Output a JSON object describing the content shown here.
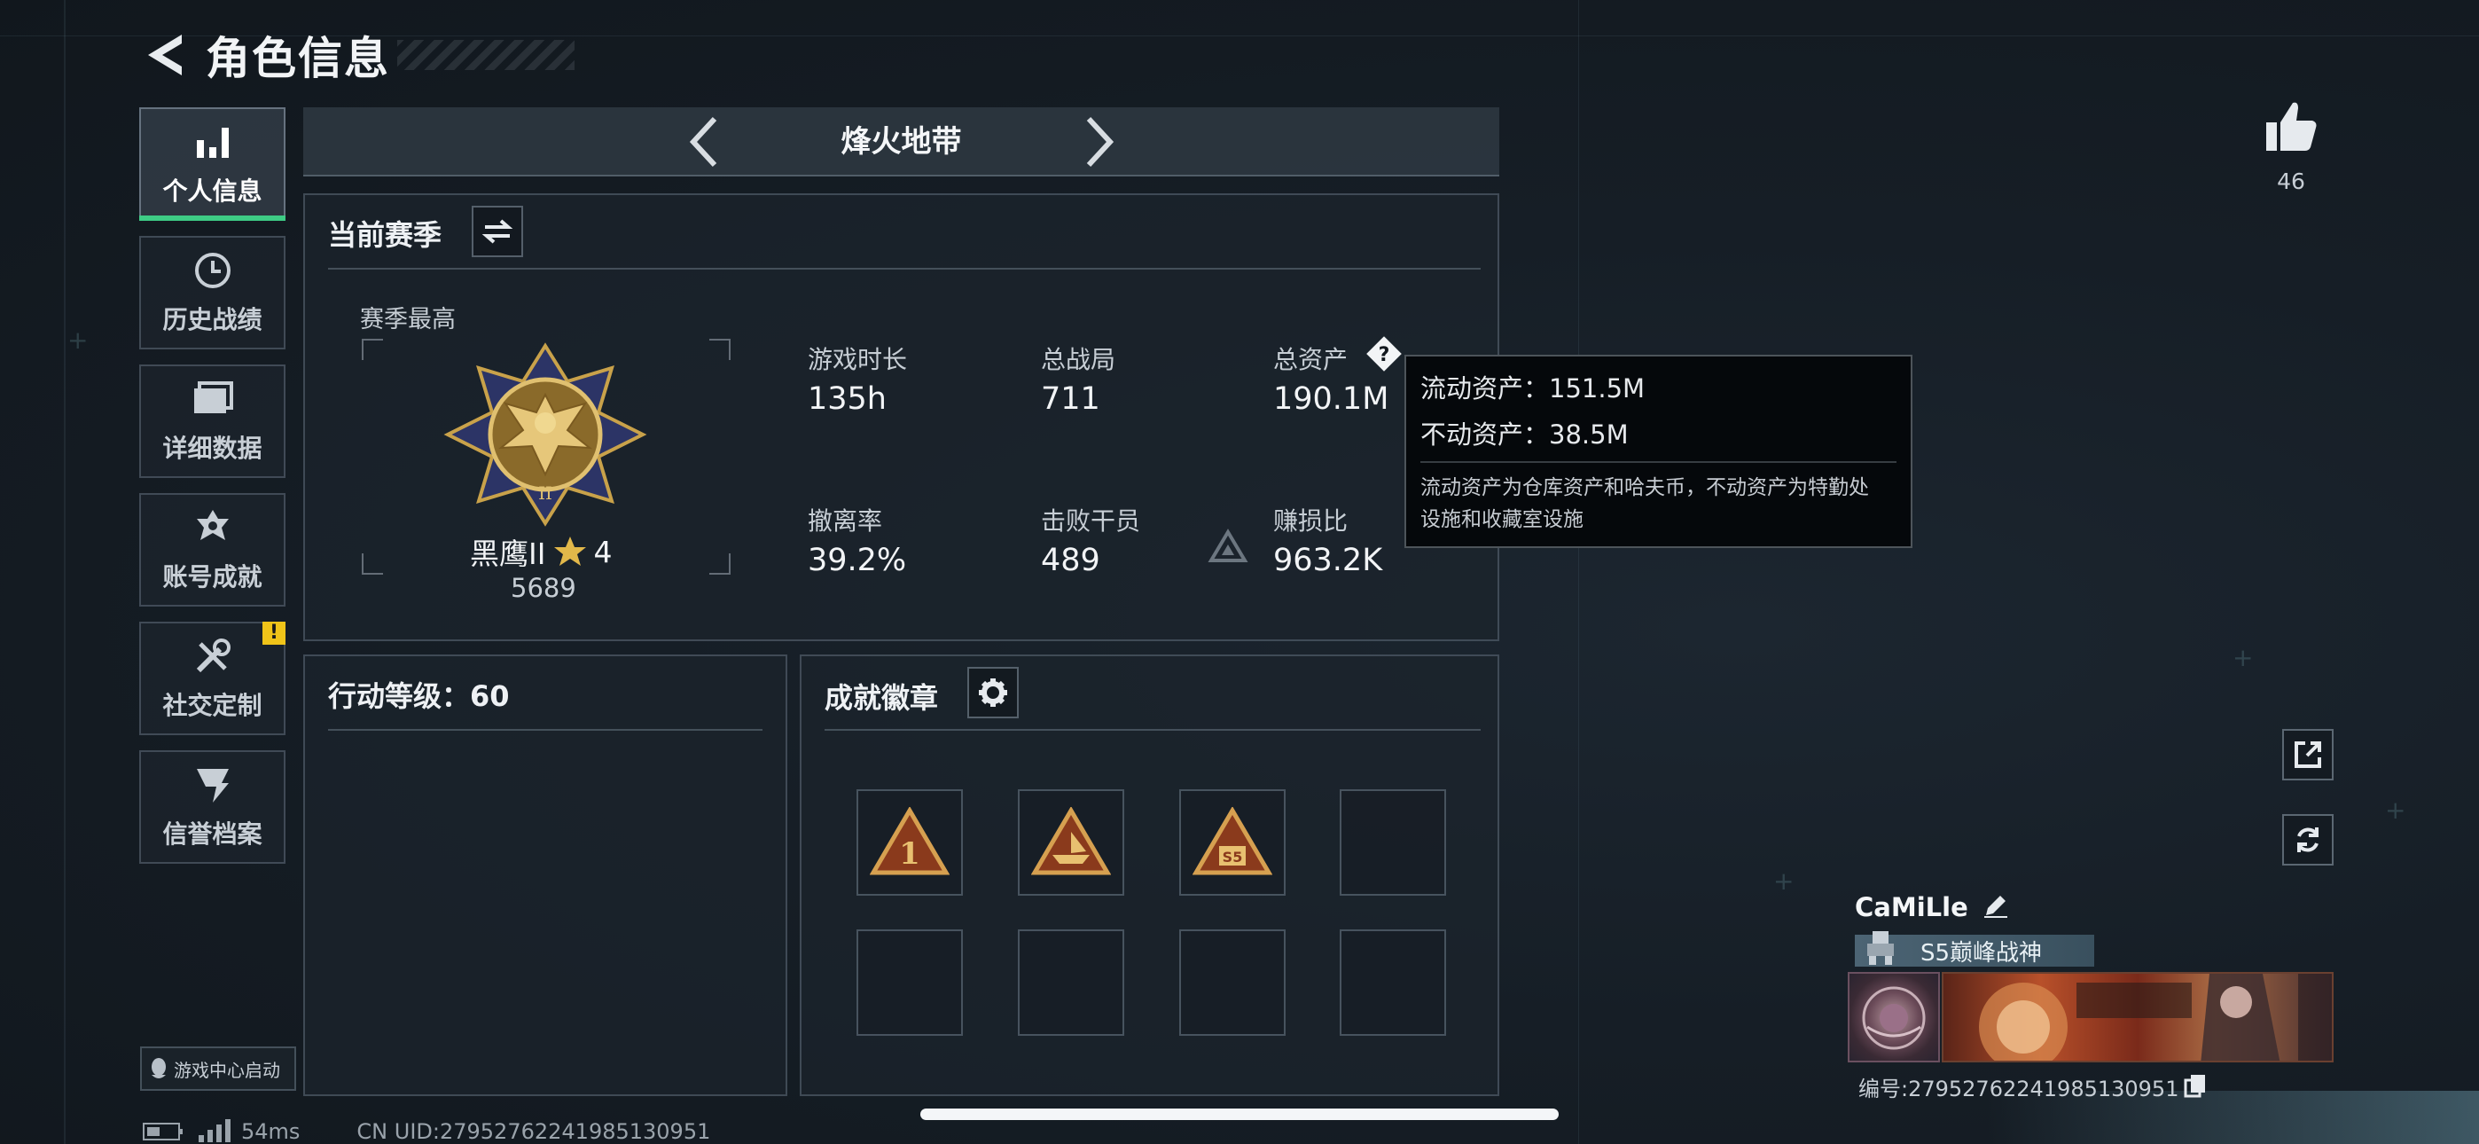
{
  "header": {
    "title": "角色信息"
  },
  "nav": {
    "items": [
      {
        "label": "个人信息",
        "active": true
      },
      {
        "label": "历史战绩"
      },
      {
        "label": "详细数据"
      },
      {
        "label": "账号成就"
      },
      {
        "label": "社交定制",
        "badge": "!"
      },
      {
        "label": "信誉档案"
      }
    ],
    "game_center": "游戏中心启动"
  },
  "mode": {
    "title": "烽火地带"
  },
  "season": {
    "title": "当前赛季",
    "best_label": "赛季最高",
    "rank_name": "黑鹰II",
    "rank_stars": "4",
    "rank_score": "5689",
    "stats": [
      {
        "label": "游戏时长",
        "value": "135h"
      },
      {
        "label": "总战局",
        "value": "711"
      },
      {
        "label": "总资产",
        "value": "190.1M"
      },
      {
        "label": "撤离率",
        "value": "39.2%"
      },
      {
        "label": "击败干员",
        "value": "489"
      },
      {
        "label": "赚损比",
        "value": "963.2K"
      }
    ]
  },
  "tooltip": {
    "liquid": "流动资产：151.5M",
    "fixed": "不动资产：38.5M",
    "note_line1": "流动资产为仓库资产和哈夫币，不动资产为特勤处",
    "note_line2": "设施和收藏室设施"
  },
  "action_level": {
    "title": "行动等级：60"
  },
  "achievements": {
    "title": "成就徽章",
    "badges": [
      "1",
      "ship",
      "S5",
      "",
      "",
      "",
      "",
      ""
    ]
  },
  "likes": {
    "count": "46"
  },
  "profile": {
    "name": "CaMiLle",
    "title_tag": "S5巅峰战神",
    "id_text": "编号:27952762241985130951"
  },
  "status_bar": {
    "ping": "54ms",
    "uid": "CN UID:27952762241985130951"
  },
  "colors": {
    "accent": "#3ecc85",
    "warn": "#f0c419",
    "gold": "#c9a24a"
  }
}
